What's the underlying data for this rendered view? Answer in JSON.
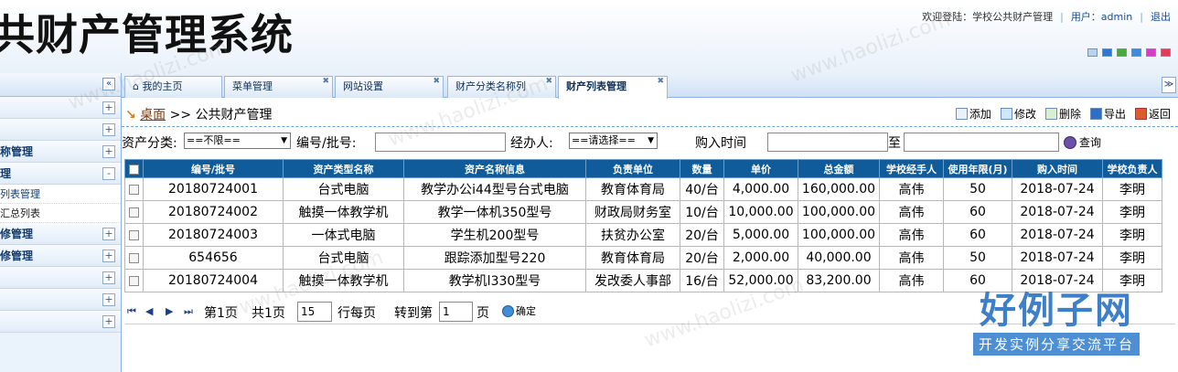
{
  "header": {
    "app_title": "共财产管理系统",
    "welcome": "欢迎登陆：学校公共财产管理",
    "user_label": "用户：admin",
    "logout": "退出",
    "theme_colors": [
      "#b7d3f0",
      "#2f77d2",
      "#4aa93e",
      "#3c8be0",
      "#d63cc8",
      "#e33a5a"
    ]
  },
  "sidebar": {
    "collapse_icon": "«",
    "groups": [
      {
        "label": "",
        "toggle": "+"
      },
      {
        "label": "",
        "toggle": "+"
      },
      {
        "label": "称管理",
        "toggle": "+"
      },
      {
        "label": "理",
        "toggle": "-",
        "items": [
          "列表管理",
          "汇总列表"
        ]
      },
      {
        "label": "修管理",
        "toggle": "+"
      },
      {
        "label": "修管理",
        "toggle": "+"
      },
      {
        "label": "",
        "toggle": "+"
      },
      {
        "label": "",
        "toggle": "+"
      },
      {
        "label": "",
        "toggle": "+"
      }
    ]
  },
  "tabs": [
    {
      "label": "我的主页"
    },
    {
      "label": "菜单管理"
    },
    {
      "label": "网站设置"
    },
    {
      "label": "财产分类名称列"
    },
    {
      "label": "财产列表管理"
    }
  ],
  "breadcrumb": {
    "home": "桌面",
    "sep": ">>",
    "current": "公共财产管理"
  },
  "toolbar": {
    "add": "添加",
    "edit": "修改",
    "delete": "删除",
    "export": "导出",
    "back": "返回"
  },
  "filters": {
    "category_label": "资产分类:",
    "category_value": "==不限==",
    "number_label": "编号/批号:",
    "handler_label": "经办人:",
    "handler_value": "==请选择==",
    "date_label": "购入时间",
    "date_to": "至",
    "search_label": "查询"
  },
  "table": {
    "headers": [
      "编号/批号",
      "资产类型名称",
      "资产名称信息",
      "负责单位",
      "数量",
      "单价",
      "总金额",
      "学校经手人",
      "使用年限(月)",
      "购入时间",
      "学校负责人"
    ],
    "rows": [
      [
        "20180724001",
        "台式电脑",
        "教学办公i44型号台式电脑",
        "教育体育局",
        "40/台",
        "4,000.00",
        "160,000.00",
        "高伟",
        "50",
        "2018-07-24",
        "李明"
      ],
      [
        "20180724002",
        "触摸一体教学机",
        "教学一体机350型号",
        "财政局财务室",
        "10/台",
        "10,000.00",
        "100,000.00",
        "高伟",
        "60",
        "2018-07-24",
        "李明"
      ],
      [
        "20180724003",
        "一体式电脑",
        "学生机200型号",
        "扶贫办公室",
        "20/台",
        "5,000.00",
        "100,000.00",
        "高伟",
        "60",
        "2018-07-24",
        "李明"
      ],
      [
        "654656",
        "台式电脑",
        "跟踪添加型号220",
        "教育体育局",
        "20/台",
        "2,000.00",
        "40,000.00",
        "高伟",
        "50",
        "2018-07-24",
        "李明"
      ],
      [
        "20180724004",
        "触摸一体教学机",
        "教学机l330型号",
        "发改委人事部",
        "16/台",
        "52,000.00",
        "83,200.00",
        "高伟",
        "60",
        "2018-07-24",
        "李明"
      ]
    ]
  },
  "pager": {
    "page_text": "第1页",
    "total_text": "共1页",
    "per_page": "15",
    "per_page_label": "行每页",
    "goto_label": "转到第",
    "goto_value": "1",
    "page_suffix": "页",
    "confirm": "确定"
  },
  "watermark": {
    "url_text": "www.haolizi.com",
    "logo_big": "好例子网",
    "logo_small": "开发实例分享交流平台"
  }
}
